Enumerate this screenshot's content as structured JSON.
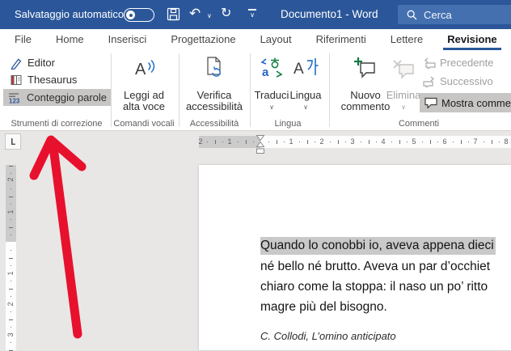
{
  "colors": {
    "titlebar": "#2b579a",
    "accent": "#2b579a",
    "searchbox": "#4470b0",
    "button-highlight": "#c8c6c4",
    "selection": "#c9c9c9",
    "arrow": "#e8112d",
    "disabled": "#a19f9d",
    "green": "#107c41",
    "ruler-gray": "#cbcbcb",
    "workspace": "#e9e7e5"
  },
  "titlebar": {
    "autosave_label": "Salvataggio automatico",
    "title": "Documento1 - Word",
    "search_label": "Cerca"
  },
  "tabs": {
    "items": [
      "File",
      "Home",
      "Inserisci",
      "Progettazione",
      "Layout",
      "Riferimenti",
      "Lettere",
      "Revisione"
    ],
    "active": "Revisione"
  },
  "ribbon": {
    "proofing": {
      "editor": "Editor",
      "thesaurus": "Thesaurus",
      "word_count": "Conteggio parole",
      "group": "Strumenti di correzione"
    },
    "voice": {
      "read_aloud_line1": "Leggi ad",
      "read_aloud_line2": "alta voce",
      "group": "Comandi vocali"
    },
    "accessibility": {
      "check_line1": "Verifica",
      "check_line2": "accessibilità",
      "group": "Accessibilità"
    },
    "language": {
      "translate": "Traduci",
      "language": "Lingua",
      "group": "Lingua"
    },
    "comments": {
      "new_line1": "Nuovo",
      "new_line2": "commento",
      "delete": "Elimina",
      "previous": "Precedente",
      "next": "Successivo",
      "show": "Mostra commen",
      "group": "Commenti"
    }
  },
  "ruler": {
    "tab_selector": "L",
    "h_gray": [
      "2",
      "1"
    ],
    "h_white": [
      "1",
      "2",
      "3",
      "4",
      "5",
      "6",
      "7",
      "8"
    ],
    "v_gray": [
      "2",
      "1"
    ],
    "v_white": [
      "1",
      "2",
      "3"
    ]
  },
  "document": {
    "line1": "Quando lo conobbi io, aveva appena dieci",
    "line2": "né bello né brutto. Aveva un par d’occhiet",
    "line3": "chiaro come la stoppa: il naso un po’ ritto",
    "line4": "magre più del bisogno.",
    "citation": "C. Collodi, L’omino anticipato"
  }
}
